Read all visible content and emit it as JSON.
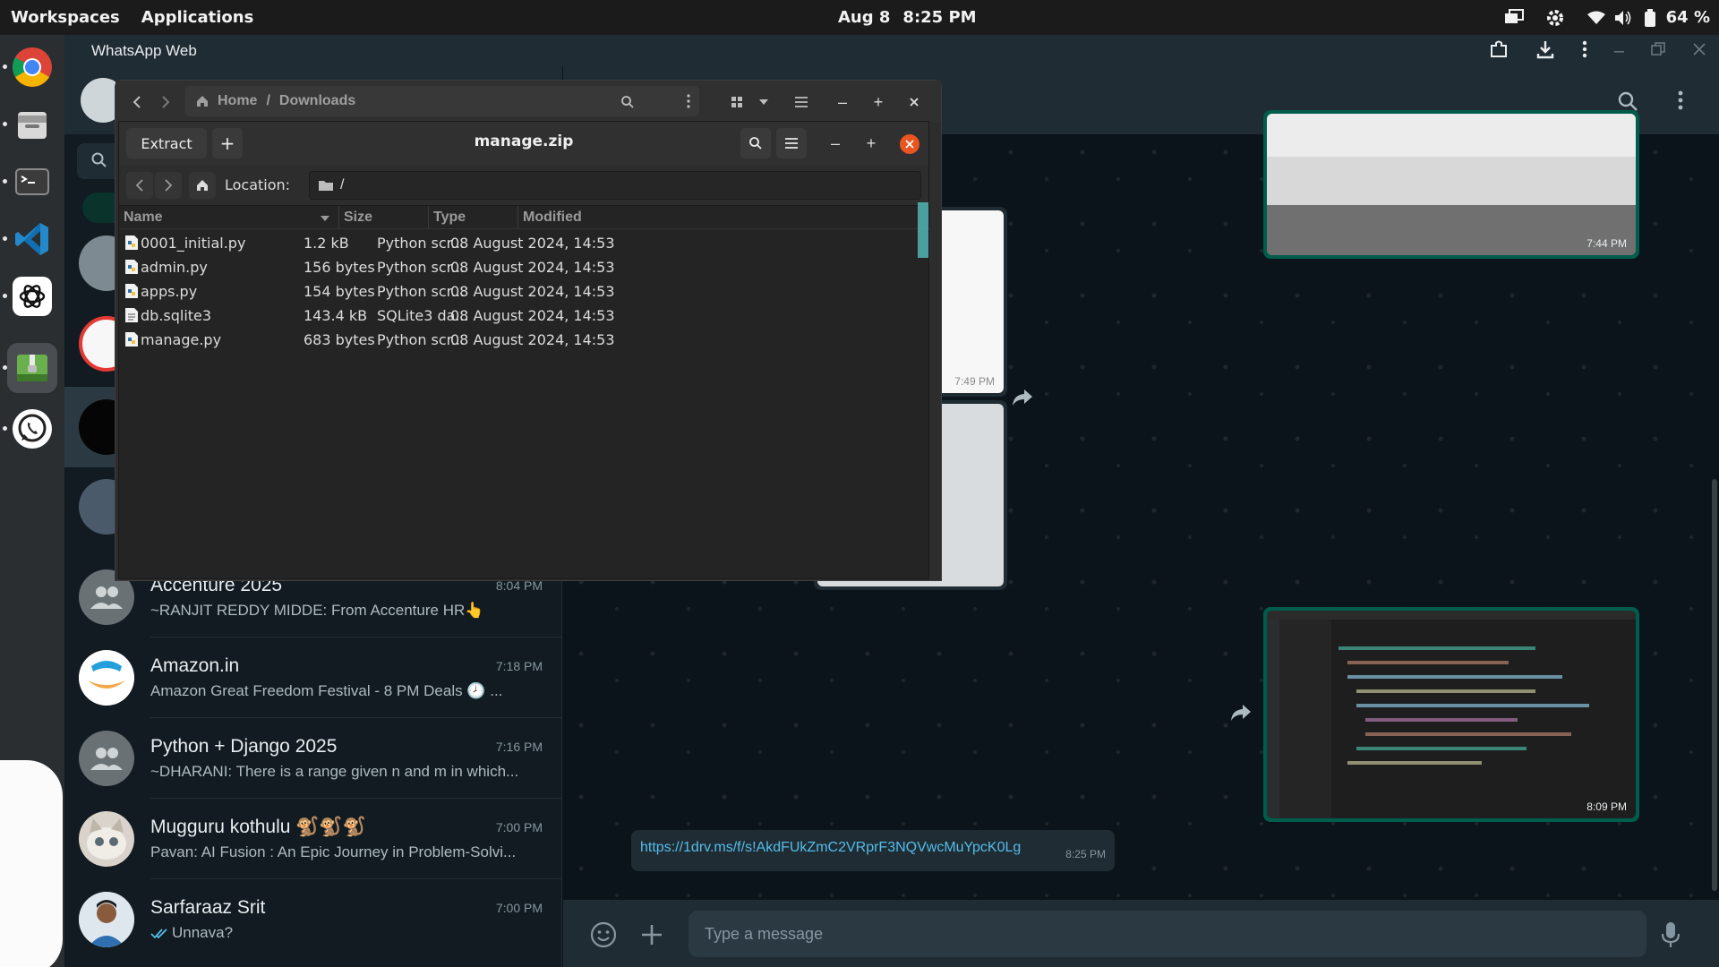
{
  "topbar": {
    "workspaces": "Workspaces",
    "applications": "Applications",
    "date": "Aug 8",
    "time": "8:25 PM",
    "battery": "64 %"
  },
  "dock": {
    "apps": [
      "chrome-icon",
      "files-icon",
      "terminal-icon",
      "vscode-icon",
      "chatgpt-icon",
      "archive-manager-icon",
      "whatsapp-icon"
    ]
  },
  "browser": {
    "title": "WhatsApp Web"
  },
  "chats": [
    {
      "name": "Accenture 2025",
      "time": "8:04 PM",
      "preview": "~RANJIT REDDY MIDDE: From Accenture HR👆"
    },
    {
      "name": "Amazon.in",
      "time": "7:18 PM",
      "preview": "Amazon Great Freedom Festival - 8 PM Deals 🕗 ..."
    },
    {
      "name": "Python + Django 2025",
      "time": "7:16 PM",
      "preview": "~DHARANI: There is a range given n and m in which..."
    },
    {
      "name": "Mugguru kothulu 🐒🐒🐒",
      "time": "7:00 PM",
      "preview": "Pavan: AI Fusion : An Epic Journey in Problem-Solvi..."
    },
    {
      "name": "Sarfaraaz Srit",
      "time": "7:00 PM",
      "preview": "Unnava?"
    }
  ],
  "conversation": {
    "media_times": [
      "7:44 PM",
      "7:49 PM",
      "8:09 PM"
    ],
    "link": "https://1drv.ms/f/s!AkdFUkZmC2VRprF3NQVwcMuYpcK0Lg",
    "link_time": "8:25 PM",
    "composer_placeholder": "Type a message"
  },
  "file_manager": {
    "breadcrumb_home": "Home",
    "breadcrumb_current": "Downloads"
  },
  "archive": {
    "title": "manage.zip",
    "extract_label": "Extract",
    "location_label": "Location:",
    "location_value": "/",
    "columns": [
      "Name",
      "Size",
      "Type",
      "Modified"
    ],
    "files": [
      {
        "name": "0001_initial.py",
        "size": "1.2 kB",
        "type": "Python scr...",
        "modified": "08 August 2024, 14:53",
        "kind": "python"
      },
      {
        "name": "admin.py",
        "size": "156 bytes",
        "type": "Python scr...",
        "modified": "08 August 2024, 14:53",
        "kind": "python"
      },
      {
        "name": "apps.py",
        "size": "154 bytes",
        "type": "Python scr...",
        "modified": "08 August 2024, 14:53",
        "kind": "python"
      },
      {
        "name": "db.sqlite3",
        "size": "143.4 kB",
        "type": "SQLite3 da...",
        "modified": "08 August 2024, 14:53",
        "kind": "database"
      },
      {
        "name": "manage.py",
        "size": "683 bytes",
        "type": "Python scr...",
        "modified": "08 August 2024, 14:53",
        "kind": "python"
      }
    ]
  },
  "colors": {
    "whatsapp_green": "#005c4b",
    "close_orange": "#e95420",
    "link_blue": "#53bdeb"
  }
}
